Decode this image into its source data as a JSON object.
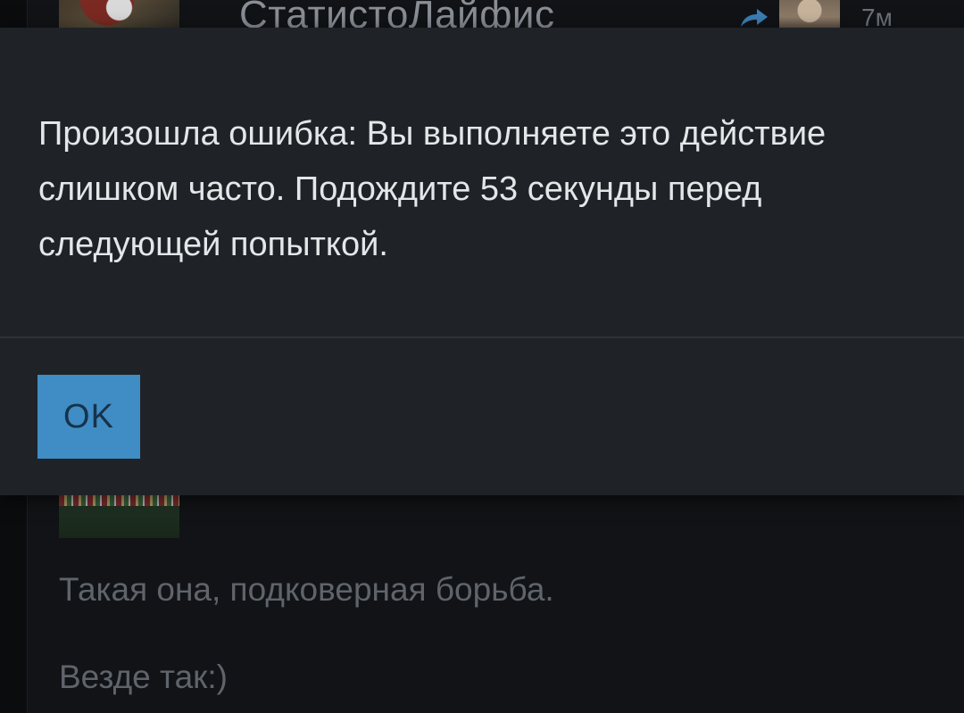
{
  "background": {
    "author_name": "СтатистоЛайфис",
    "time_ago": "7м",
    "comments": [
      "Такая она, подковерная борьба.",
      "Везде так:)"
    ]
  },
  "dialog": {
    "message": "Произошла ошибка: Вы выполняете это действие слишком часто. Подождите 53 секунды перед следующей попыткой.",
    "ok_label": "OK",
    "accent_color": "#3f8dc4",
    "background_color": "#1f2327"
  }
}
